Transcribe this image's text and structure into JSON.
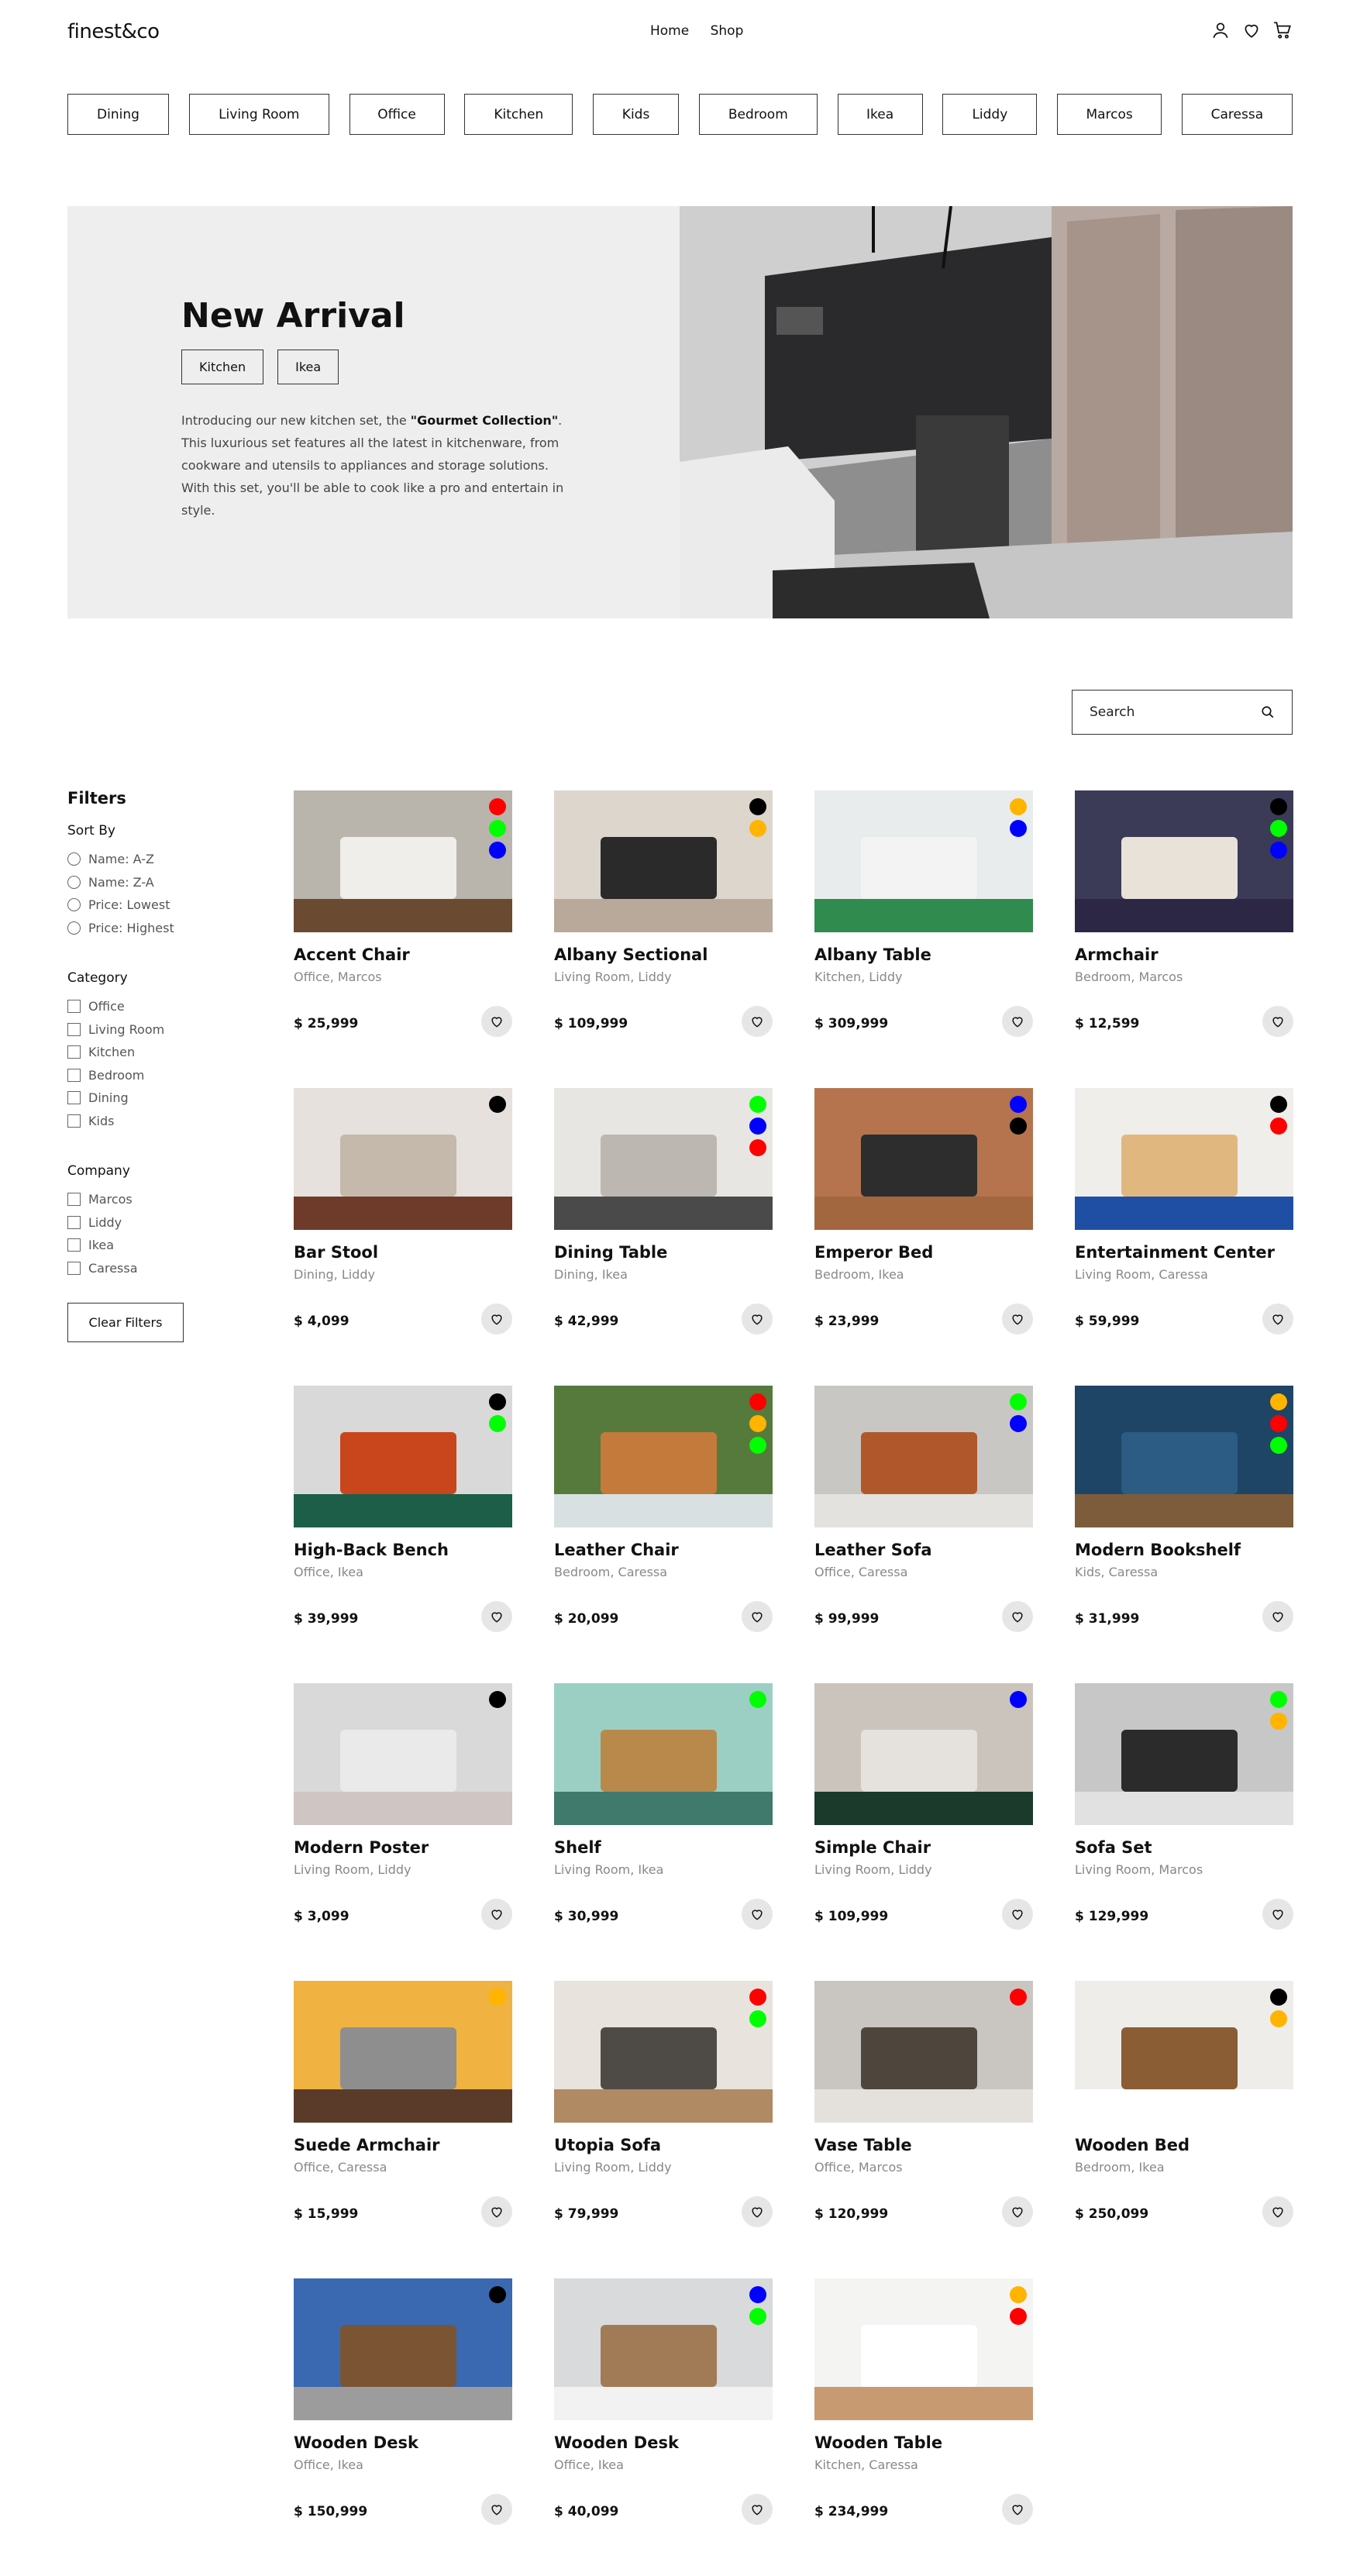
{
  "brand": "finest&co",
  "nav": [
    "Home",
    "Shop"
  ],
  "categories": [
    "Dining",
    "Living Room",
    "Office",
    "Kitchen",
    "Kids",
    "Bedroom",
    "Ikea",
    "Liddy",
    "Marcos",
    "Caressa"
  ],
  "hero": {
    "title": "New Arrival",
    "tags": [
      "Kitchen",
      "Ikea"
    ],
    "desc_pre": "Introducing our new kitchen set, the ",
    "desc_bold": "\"Gourmet Collection\"",
    "desc_post": ". This luxurious set features all the latest in kitchenware, from cookware and utensils to appliances and storage solutions. With this set, you'll be able to cook like a pro and entertain in style."
  },
  "search": {
    "placeholder": "Search"
  },
  "filters": {
    "title": "Filters",
    "sort_title": "Sort By",
    "sort": [
      "Name: A-Z",
      "Name: Z-A",
      "Price: Lowest",
      "Price: Highest"
    ],
    "category_title": "Category",
    "category": [
      "Office",
      "Living Room",
      "Kitchen",
      "Bedroom",
      "Dining",
      "Kids"
    ],
    "company_title": "Company",
    "company": [
      "Marcos",
      "Liddy",
      "Ikea",
      "Caressa"
    ],
    "clear": "Clear Filters"
  },
  "products": [
    {
      "name": "Accent Chair",
      "meta": "Office, Marcos",
      "price": "$ 25,999",
      "colors": [
        "#ff0000",
        "#00ff00",
        "#0000ff"
      ],
      "img": [
        "#b9b4ac",
        "#efeeea",
        "#6b4a32"
      ]
    },
    {
      "name": "Albany Sectional",
      "meta": "Living Room, Liddy",
      "price": "$ 109,999",
      "colors": [
        "#000000",
        "#ffb400"
      ],
      "img": [
        "#dcd6cd",
        "#2a2a2a",
        "#b8a99a"
      ]
    },
    {
      "name": "Albany Table",
      "meta": "Kitchen, Liddy",
      "price": "$ 309,999",
      "colors": [
        "#ffb400",
        "#0000ff"
      ],
      "img": [
        "#e9ecec",
        "#f3f3f3",
        "#2f8b4e"
      ]
    },
    {
      "name": "Armchair",
      "meta": "Bedroom, Marcos",
      "price": "$ 12,599",
      "colors": [
        "#000000",
        "#00ff00",
        "#0000ff"
      ],
      "img": [
        "#3b3a57",
        "#e9e2d8",
        "#2b2744"
      ]
    },
    {
      "name": "Bar Stool",
      "meta": "Dining, Liddy",
      "price": "$ 4,099",
      "colors": [
        "#000000"
      ],
      "img": [
        "#e6e1dc",
        "#c5b9ac",
        "#6e3a2a"
      ]
    },
    {
      "name": "Dining Table",
      "meta": "Dining, Ikea",
      "price": "$ 42,999",
      "colors": [
        "#00ff00",
        "#0000ff",
        "#ff0000"
      ],
      "img": [
        "#e7e6e2",
        "#bdb7b1",
        "#4a4a4a"
      ]
    },
    {
      "name": "Emperor Bed",
      "meta": "Bedroom, Ikea",
      "price": "$ 23,999",
      "colors": [
        "#0000ff",
        "#000000"
      ],
      "img": [
        "#b5744d",
        "#2d2d2d",
        "#a2673f"
      ]
    },
    {
      "name": "Entertainment Center",
      "meta": "Living Room, Caressa",
      "price": "$ 59,999",
      "colors": [
        "#000000",
        "#ff0000"
      ],
      "img": [
        "#f0eeeb",
        "#e1b780",
        "#1e4fa5"
      ]
    },
    {
      "name": "High-Back Bench",
      "meta": "Office, Ikea",
      "price": "$ 39,999",
      "colors": [
        "#000000",
        "#00ff00"
      ],
      "img": [
        "#d8d9d8",
        "#c9451c",
        "#1d5e49"
      ]
    },
    {
      "name": "Leather Chair",
      "meta": "Bedroom, Caressa",
      "price": "$ 20,099",
      "colors": [
        "#ff0000",
        "#ffb400",
        "#00ff00"
      ],
      "img": [
        "#567a3c",
        "#c37a3b",
        "#d9e0e2"
      ]
    },
    {
      "name": "Leather Sofa",
      "meta": "Office, Caressa",
      "price": "$ 99,999",
      "colors": [
        "#00ff00",
        "#0000ff"
      ],
      "img": [
        "#c9c7c4",
        "#b0582b",
        "#e3e2df"
      ]
    },
    {
      "name": "Modern Bookshelf",
      "meta": "Kids, Caressa",
      "price": "$ 31,999",
      "colors": [
        "#ffb400",
        "#ff0000",
        "#00ff00"
      ],
      "img": [
        "#1e4466",
        "#2c5b83",
        "#7c5c3a"
      ]
    },
    {
      "name": "Modern Poster",
      "meta": "Living Room, Liddy",
      "price": "$ 3,099",
      "colors": [
        "#000000"
      ],
      "img": [
        "#d9d9d9",
        "#ebeaea",
        "#cfc6c4"
      ]
    },
    {
      "name": "Shelf",
      "meta": "Living Room, Ikea",
      "price": "$ 30,999",
      "colors": [
        "#00ff00"
      ],
      "img": [
        "#9ccfc4",
        "#b8894a",
        "#3f7a6c"
      ]
    },
    {
      "name": "Simple Chair",
      "meta": "Living Room, Liddy",
      "price": "$ 109,999",
      "colors": [
        "#0000ff"
      ],
      "img": [
        "#cbc4bd",
        "#e5e1dc",
        "#1b3a2b"
      ]
    },
    {
      "name": "Sofa Set",
      "meta": "Living Room, Marcos",
      "price": "$ 129,999",
      "colors": [
        "#00ff00",
        "#ffb400"
      ],
      "img": [
        "#c7c7c7",
        "#2b2b2b",
        "#e1e1e1"
      ]
    },
    {
      "name": "Suede Armchair",
      "meta": "Office, Caressa",
      "price": "$ 15,999",
      "colors": [
        "#ffb400"
      ],
      "img": [
        "#f0b240",
        "#8e8e8e",
        "#5a3b2a"
      ]
    },
    {
      "name": "Utopia Sofa",
      "meta": "Living Room, Liddy",
      "price": "$ 79,999",
      "colors": [
        "#ff0000",
        "#00ff00"
      ],
      "img": [
        "#e8e4dd",
        "#4e4b47",
        "#b08a63"
      ]
    },
    {
      "name": "Vase Table",
      "meta": "Office, Marcos",
      "price": "$ 120,999",
      "colors": [
        "#ff0000"
      ],
      "img": [
        "#c9c6c2",
        "#4e463c",
        "#e4e1dd"
      ]
    },
    {
      "name": "Wooden Bed",
      "meta": "Bedroom, Ikea",
      "price": "$ 250,099",
      "colors": [
        "#000000",
        "#ffb400"
      ],
      "img": [
        "#efedea",
        "#8a5d34",
        "#ffffff"
      ]
    },
    {
      "name": "Wooden Desk",
      "meta": "Office, Ikea",
      "price": "$ 150,999",
      "colors": [
        "#000000"
      ],
      "img": [
        "#3a69b1",
        "#7b5433",
        "#9c9c9c"
      ]
    },
    {
      "name": "Wooden Desk",
      "meta": "Office, Ikea",
      "price": "$ 40,099",
      "colors": [
        "#0000ff",
        "#00ff00"
      ],
      "img": [
        "#d8dadb",
        "#a07b55",
        "#f2f2f2"
      ]
    },
    {
      "name": "Wooden Table",
      "meta": "Kitchen, Caressa",
      "price": "$ 234,999",
      "colors": [
        "#ffb400",
        "#ff0000"
      ],
      "img": [
        "#f4f4f3",
        "#ffffff",
        "#c89a72"
      ]
    }
  ]
}
